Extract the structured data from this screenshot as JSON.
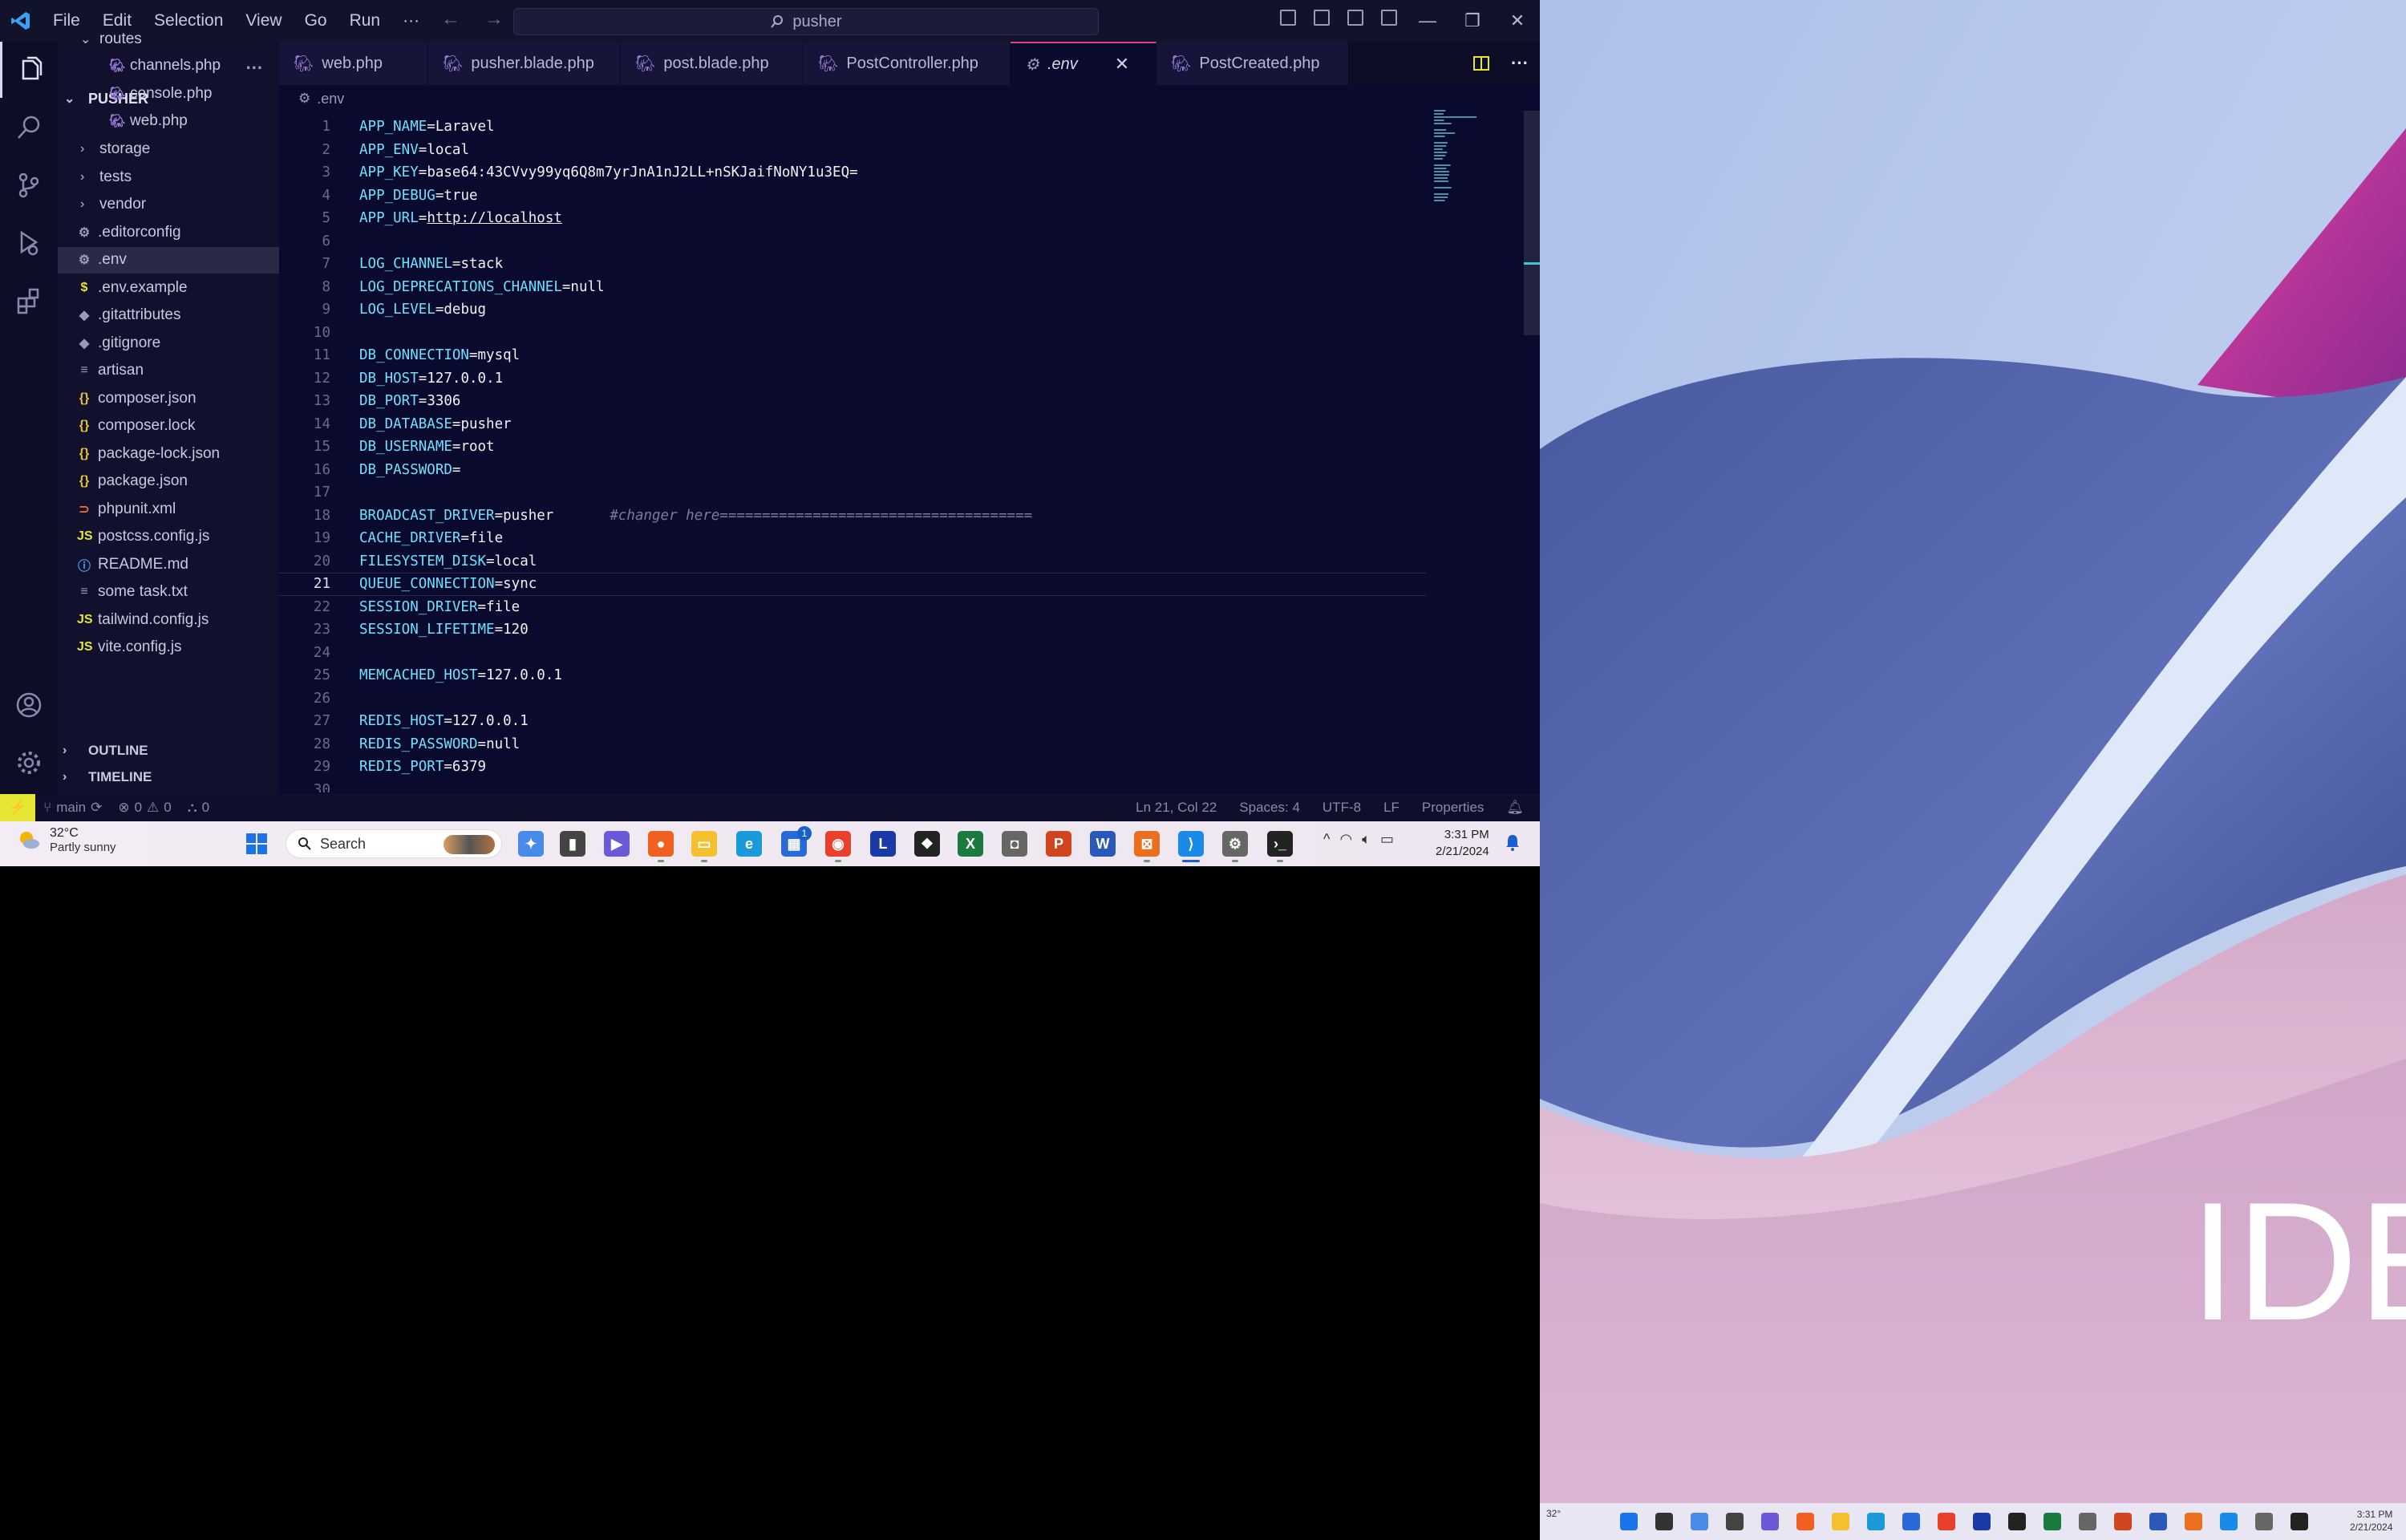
{
  "titlebar": {
    "menu": [
      "File",
      "Edit",
      "Selection",
      "View",
      "Go",
      "Run"
    ],
    "more": "···",
    "search_text": "pusher"
  },
  "sidebar": {
    "header": "...",
    "project": "PUSHER",
    "items": [
      {
        "label": "routes",
        "type": "folder-open",
        "indent": 1
      },
      {
        "label": "channels.php",
        "type": "php",
        "indent": 2
      },
      {
        "label": "console.php",
        "type": "php",
        "indent": 2
      },
      {
        "label": "web.php",
        "type": "php",
        "indent": 2
      },
      {
        "label": "storage",
        "type": "folder",
        "indent": 1
      },
      {
        "label": "tests",
        "type": "folder",
        "indent": 1
      },
      {
        "label": "vendor",
        "type": "folder",
        "indent": 1
      },
      {
        "label": ".editorconfig",
        "type": "gear",
        "indent": 1
      },
      {
        "label": ".env",
        "type": "gear",
        "indent": 1
      },
      {
        "label": ".env.example",
        "type": "dollar",
        "indent": 1
      },
      {
        "label": ".gitattributes",
        "type": "git",
        "indent": 1
      },
      {
        "label": ".gitignore",
        "type": "git",
        "indent": 1
      },
      {
        "label": "artisan",
        "type": "lines",
        "indent": 1
      },
      {
        "label": "composer.json",
        "type": "json",
        "indent": 1
      },
      {
        "label": "composer.lock",
        "type": "json",
        "indent": 1
      },
      {
        "label": "package-lock.json",
        "type": "json",
        "indent": 1
      },
      {
        "label": "package.json",
        "type": "json",
        "indent": 1
      },
      {
        "label": "phpunit.xml",
        "type": "rss",
        "indent": 1
      },
      {
        "label": "postcss.config.js",
        "type": "js",
        "indent": 1
      },
      {
        "label": "README.md",
        "type": "info",
        "indent": 1
      },
      {
        "label": "some task.txt",
        "type": "lines",
        "indent": 1
      },
      {
        "label": "tailwind.config.js",
        "type": "js",
        "indent": 1
      },
      {
        "label": "vite.config.js",
        "type": "js",
        "indent": 1
      }
    ],
    "outline": "OUTLINE",
    "timeline": "TIMELINE"
  },
  "tabs": [
    {
      "label": "web.php",
      "active": false
    },
    {
      "label": "pusher.blade.php",
      "active": false
    },
    {
      "label": "post.blade.php",
      "active": false
    },
    {
      "label": "PostController.php",
      "active": false
    },
    {
      "label": ".env",
      "active": true
    },
    {
      "label": "PostCreated.php",
      "active": false
    }
  ],
  "breadcrumb": ".env",
  "editor": {
    "current_line": 21,
    "lines": [
      {
        "n": "1",
        "key": "APP_NAME",
        "val": "Laravel"
      },
      {
        "n": "2",
        "key": "APP_ENV",
        "val": "local"
      },
      {
        "n": "3",
        "key": "APP_KEY",
        "val": "base64:43CVvy99yq6Q8m7yrJnA1nJ2LL+nSKJaifNoNY1u3EQ="
      },
      {
        "n": "4",
        "key": "APP_DEBUG",
        "val": "true"
      },
      {
        "n": "5",
        "key": "APP_URL",
        "val": "http://localhost",
        "link": true
      },
      {
        "n": "6"
      },
      {
        "n": "7",
        "key": "LOG_CHANNEL",
        "val": "stack"
      },
      {
        "n": "8",
        "key": "LOG_DEPRECATIONS_CHANNEL",
        "val": "null"
      },
      {
        "n": "9",
        "key": "LOG_LEVEL",
        "val": "debug"
      },
      {
        "n": "10"
      },
      {
        "n": "11",
        "key": "DB_CONNECTION",
        "val": "mysql"
      },
      {
        "n": "12",
        "key": "DB_HOST",
        "val": "127.0.0.1"
      },
      {
        "n": "13",
        "key": "DB_PORT",
        "val": "3306"
      },
      {
        "n": "14",
        "key": "DB_DATABASE",
        "val": "pusher"
      },
      {
        "n": "15",
        "key": "DB_USERNAME",
        "val": "root"
      },
      {
        "n": "16",
        "key": "DB_PASSWORD",
        "val": ""
      },
      {
        "n": "17"
      },
      {
        "n": "18",
        "key": "BROADCAST_DRIVER",
        "val": "pusher",
        "comment": "#changer here====================================="
      },
      {
        "n": "19",
        "key": "CACHE_DRIVER",
        "val": "file"
      },
      {
        "n": "20",
        "key": "FILESYSTEM_DISK",
        "val": "local"
      },
      {
        "n": "21",
        "key": "QUEUE_CONNECTION",
        "val": "sync"
      },
      {
        "n": "22",
        "key": "SESSION_DRIVER",
        "val": "file"
      },
      {
        "n": "23",
        "key": "SESSION_LIFETIME",
        "val": "120"
      },
      {
        "n": "24"
      },
      {
        "n": "25",
        "key": "MEMCACHED_HOST",
        "val": "127.0.0.1"
      },
      {
        "n": "26"
      },
      {
        "n": "27",
        "key": "REDIS_HOST",
        "val": "127.0.0.1"
      },
      {
        "n": "28",
        "key": "REDIS_PASSWORD",
        "val": "null"
      },
      {
        "n": "29",
        "key": "REDIS_PORT",
        "val": "6379"
      },
      {
        "n": "30"
      }
    ]
  },
  "statusbar": {
    "branch": "main",
    "errors": "0",
    "warnings": "0",
    "ports": "0",
    "position": "Ln 21, Col 22",
    "spaces": "Spaces: 4",
    "encoding": "UTF-8",
    "eol": "LF",
    "language": "Properties"
  },
  "taskbar": {
    "temp": "32°C",
    "weather": "Partly sunny",
    "search_placeholder": "Search",
    "time": "3:31 PM",
    "date": "2/21/2024",
    "store_badge": "1"
  },
  "taskbar2": {
    "temp": "32°",
    "time": "3:31 PM",
    "date": "2/21/2024"
  },
  "wallpaper": {
    "text": "IDE"
  },
  "colors": {
    "accent": "#e23f8a",
    "editor_bg": "#0a0a2e",
    "key": "#6ee0ff",
    "remote": "#e6e635"
  }
}
